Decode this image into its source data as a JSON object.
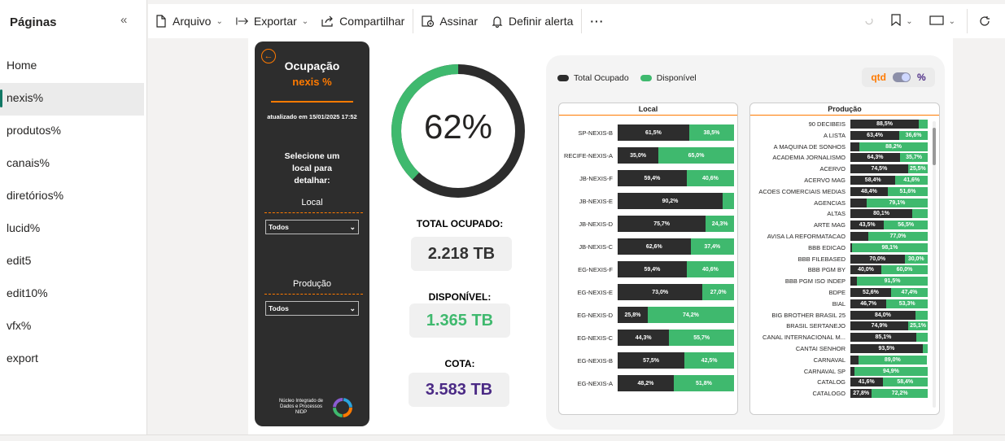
{
  "sidebar": {
    "title": "Páginas",
    "collapse_icon": "double-chevron-left-icon",
    "items": [
      {
        "label": "Home"
      },
      {
        "label": "nexis%"
      },
      {
        "label": "produtos%"
      },
      {
        "label": "canais%"
      },
      {
        "label": "diretórios%"
      },
      {
        "label": "lucid%"
      },
      {
        "label": "edit5"
      },
      {
        "label": "edit10%"
      },
      {
        "label": "vfx%"
      },
      {
        "label": "export"
      }
    ],
    "active_index": 1
  },
  "toolbar": {
    "file_label": "Arquivo",
    "export_label": "Exportar",
    "share_label": "Compartilhar",
    "sign_label": "Assinar",
    "alert_label": "Definir alerta",
    "more_label": "···"
  },
  "dashboard": {
    "back_icon": "arrow-left-circle-icon",
    "title": "Ocupação",
    "subtitle": "nexis %",
    "updated": "atualizado em 15/01/2025 17:52",
    "select_prompt": "Selecione um local para detalhar:",
    "filter_local_label": "Local",
    "filter_local_value": "Todos",
    "filter_producao_label": "Produção",
    "filter_producao_value": "Todos",
    "logo_text_1": "Núcleo Integrado de",
    "logo_text_2": "Dados e Processos",
    "logo_text_3": "NIDP",
    "donut_value": "62%",
    "donut_fraction": 0.62,
    "total_ocupado_label": "TOTAL OCUPADO:",
    "total_ocupado_value": "2.218 TB",
    "disponivel_label": "DISPONÍVEL:",
    "disponivel_value": "1.365 TB",
    "cota_label": "COTA:",
    "cota_value": "3.583 TB",
    "legend_ocupado": "Total Ocupado",
    "legend_disponivel": "Disponível",
    "toggle_left": "qtd",
    "toggle_right": "%",
    "colors": {
      "dark": "#2d2d2d",
      "green": "#3fb96e",
      "orange": "#ff7a00",
      "purple": "#4b2a85"
    }
  },
  "chart_data": [
    {
      "type": "bar",
      "title": "Local",
      "stacked": true,
      "orientation": "horizontal",
      "categories": [
        "SP-NEXIS-B",
        "RECIFE-NEXIS-A",
        "JB-NEXIS-F",
        "JB-NEXIS-E",
        "JB-NEXIS-D",
        "JB-NEXIS-C",
        "EG-NEXIS-F",
        "EG-NEXIS-E",
        "EG-NEXIS-D",
        "EG-NEXIS-C",
        "EG-NEXIS-B",
        "EG-NEXIS-A"
      ],
      "series": [
        {
          "name": "Total Ocupado",
          "values": [
            61.5,
            35.0,
            59.4,
            90.2,
            75.7,
            62.6,
            59.4,
            73.0,
            25.8,
            44.3,
            57.5,
            48.2
          ],
          "labels": [
            "61,5%",
            "35,0%",
            "59,4%",
            "90,2%",
            "75,7%",
            "62,6%",
            "59,4%",
            "73,0%",
            "25,8%",
            "44,3%",
            "57,5%",
            "48,2%"
          ]
        },
        {
          "name": "Disponível",
          "values": [
            38.5,
            65.0,
            40.6,
            9.8,
            24.3,
            37.4,
            40.6,
            27.0,
            74.2,
            55.7,
            42.5,
            51.8
          ],
          "labels": [
            "38,5%",
            "65,0%",
            "40,6%",
            "",
            "24,3%",
            "37,4%",
            "40,6%",
            "27,0%",
            "74,2%",
            "55,7%",
            "42,5%",
            "51,8%"
          ]
        }
      ]
    },
    {
      "type": "bar",
      "title": "Produção",
      "stacked": true,
      "orientation": "horizontal",
      "categories": [
        "90 DECIBEIS",
        "A LISTA",
        "A MAQUINA DE SONHOS",
        "ACADEMIA JORNALISMO",
        "ACERVO",
        "ACERVO MAG",
        "ACOES COMERCIAIS MEDIAS",
        "AGENCIAS",
        "ALTAS",
        "ARTE MAG",
        "AVISA LA REFORMATACAO",
        "BBB EDICAO",
        "BBB FILEBASED",
        "BBB PGM BY",
        "BBB PGM ISO INDEP",
        "BDPE",
        "BIAL",
        "BIG BROTHER BRASIL 25",
        "BRASIL SERTANEJO",
        "CANAL INTERNACIONAL M...",
        "CANTAI SENHOR",
        "CARNAVAL",
        "CARNAVAL SP",
        "CATALOG",
        "CATALOGO"
      ],
      "series": [
        {
          "name": "Total Ocupado",
          "values": [
            88.5,
            63.4,
            11.8,
            64.3,
            74.5,
            58.4,
            48.4,
            20.9,
            80.1,
            43.5,
            23.0,
            1.9,
            70.0,
            40.0,
            8.5,
            52.6,
            46.7,
            84.0,
            74.9,
            85.1,
            93.5,
            10.0,
            5.1,
            41.6,
            27.8
          ],
          "labels": [
            "88,5%",
            "63,4%",
            "",
            "64,3%",
            "74,5%",
            "58,4%",
            "48,4%",
            "",
            "80,1%",
            "43,5%",
            "",
            "",
            "70,0%",
            "40,0%",
            "",
            "52,6%",
            "46,7%",
            "84,0%",
            "74,9%",
            "85,1%",
            "93,5%",
            "",
            "",
            "41,6%",
            "27,8%"
          ]
        },
        {
          "name": "Disponível",
          "values": [
            11.5,
            36.6,
            88.2,
            35.7,
            25.5,
            41.6,
            51.6,
            79.1,
            19.9,
            56.5,
            77.0,
            98.1,
            30.0,
            60.0,
            91.5,
            47.4,
            53.3,
            16.0,
            25.1,
            14.9,
            6.5,
            89.0,
            94.9,
            58.4,
            72.2
          ],
          "labels": [
            "",
            "36,6%",
            "88,2%",
            "35,7%",
            "25,5%",
            "41,6%",
            "51,6%",
            "79,1%",
            "",
            "56,5%",
            "77,0%",
            "98,1%",
            "30,0%",
            "60,0%",
            "91,5%",
            "47,4%",
            "53,3%",
            "",
            "25,1%",
            "",
            "",
            "89,0%",
            "94,9%",
            "58,4%",
            "72,2%"
          ]
        }
      ]
    }
  ]
}
